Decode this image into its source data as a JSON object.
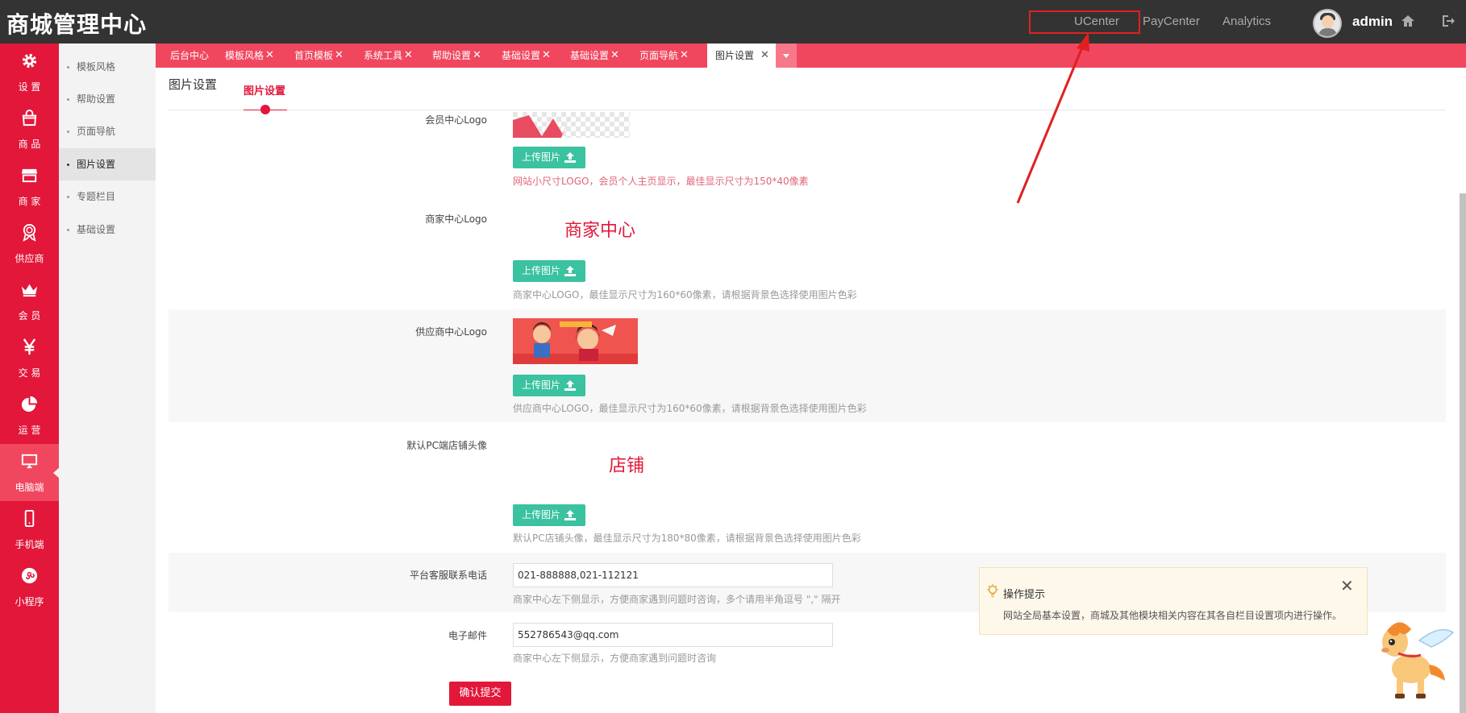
{
  "header": {
    "brand": "商城管理中心",
    "links": [
      {
        "label": "UCenter"
      },
      {
        "label": "PayCenter"
      },
      {
        "label": "Analytics"
      }
    ],
    "user": "admin",
    "icons": [
      "home-icon",
      "logout-icon"
    ]
  },
  "leftnav": [
    {
      "label": "设 置",
      "icon": "gear-icon"
    },
    {
      "label": "商 品",
      "icon": "shopping-bag-icon"
    },
    {
      "label": "商 家",
      "icon": "store-icon"
    },
    {
      "label": "供应商",
      "icon": "medal-icon"
    },
    {
      "label": "会 员",
      "icon": "crown-icon"
    },
    {
      "label": "交 易",
      "icon": "yen-icon"
    },
    {
      "label": "运 营",
      "icon": "pie-chart-icon"
    },
    {
      "label": "电脑端",
      "icon": "monitor-icon",
      "active": true
    },
    {
      "label": "手机端",
      "icon": "mobile-icon"
    },
    {
      "label": "小程序",
      "icon": "miniprogram-icon"
    }
  ],
  "subnav": [
    {
      "label": "模板风格"
    },
    {
      "label": "帮助设置"
    },
    {
      "label": "页面导航"
    },
    {
      "label": "图片设置",
      "active": true
    },
    {
      "label": "专题栏目"
    },
    {
      "label": "基础设置"
    }
  ],
  "tabs": [
    {
      "label": "后台中心"
    },
    {
      "label": "模板风格",
      "close": "✕"
    },
    {
      "label": "首页模板",
      "close": "✕"
    },
    {
      "label": "系统工具",
      "close": "✕"
    },
    {
      "label": "帮助设置",
      "close": "✕"
    },
    {
      "label": "基础设置",
      "close": "✕"
    },
    {
      "label": "基础设置",
      "close": "✕"
    },
    {
      "label": "页面导航",
      "close": "✕"
    },
    {
      "label": "图片设置",
      "close": "✕",
      "active": true
    }
  ],
  "content": {
    "title": "图片设置",
    "subtab": "图片设置",
    "upload_label": "上传图片",
    "fields": {
      "member_logo": {
        "label": "会员中心Logo",
        "hint": "网站小尺寸LOGO，会员个人主页显示，最佳显示尺寸为150*40像素"
      },
      "merchant_logo": {
        "label": "商家中心Logo",
        "logo_text": "商家中心",
        "hint": "商家中心LOGO，最佳显示尺寸为160*60像素，请根据背景色选择使用图片色彩"
      },
      "supplier_logo": {
        "label": "供应商中心Logo",
        "hint": "供应商中心LOGO，最佳显示尺寸为160*60像素，请根据背景色选择使用图片色彩"
      },
      "shop_avatar": {
        "label": "默认PC端店铺头像",
        "logo_text": "店铺",
        "hint": "默认PC店铺头像，最佳显示尺寸为180*80像素，请根据背景色选择使用图片色彩"
      },
      "phone": {
        "label": "平台客服联系电话",
        "value": "021-888888,021-112121",
        "hint": "商家中心左下侧显示，方便商家遇到问题时咨询，多个请用半角逗号 \",\" 隔开"
      },
      "email": {
        "label": "电子邮件",
        "value": "552786543@qq.com",
        "hint": "商家中心左下侧显示，方便商家遇到问题时咨询"
      }
    },
    "submit": "确认提交"
  },
  "tip": {
    "title": "操作提示",
    "text": "网站全局基本设置，商城及其他模块相关内容在其各自栏目设置项内进行操作。",
    "close": "✕"
  },
  "colors": {
    "topbar": "#333333",
    "accent": "#e2173a",
    "tabbar": "#f0475f",
    "upload": "#3bc2a0"
  }
}
